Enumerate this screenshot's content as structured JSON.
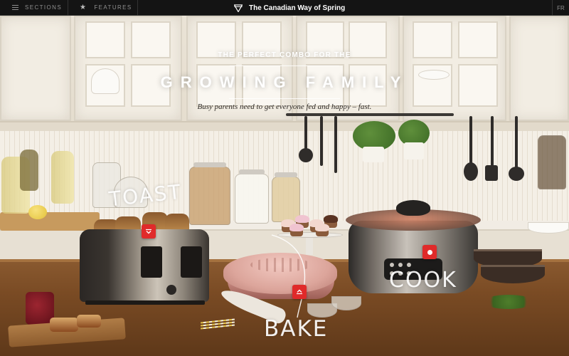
{
  "nav": {
    "sections_label": "SECTIONS",
    "features_label": "FEATURES",
    "brand_title": "The Canadian Way of Spring",
    "language_label": "FR"
  },
  "hero": {
    "kicker": "THE PERFECT COMBO FOR THE",
    "headline": "GROWING FAMILY",
    "deck": "Busy parents need to get everyone fed and happy – fast."
  },
  "appliances": {
    "toast_label": "TOAST",
    "bake_label": "BAKE",
    "cook_label": "COOK"
  },
  "colors": {
    "nav_background": "#141414",
    "hotspot_red": "#e02a2a",
    "headline_text": "#ffffff"
  },
  "icons": {
    "sections": "hamburger-icon",
    "features": "star-icon",
    "brand": "diamond-logo-icon",
    "hotspot_toast": "chevron-down-icon",
    "hotspot_bake": "chevron-up-icon",
    "hotspot_cook": "dot-icon"
  }
}
